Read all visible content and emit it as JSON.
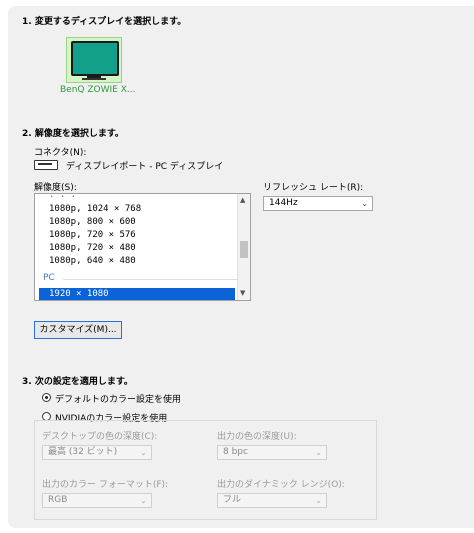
{
  "step1": {
    "title": "1. 変更するディスプレイを選択します。",
    "displays": [
      {
        "name": "BenQ ZOWIE X..."
      }
    ]
  },
  "step2": {
    "title": "2. 解像度を選択します。",
    "connector_label": "コネクタ(N):",
    "connector_value": "ディスプレイポート - PC ディスプレイ",
    "resolution_label": "解像度(S):",
    "resolution_items": [
      "1080p, 1024 × 768",
      "1080p, 800 × 600",
      "1080p, 720 × 576",
      "1080p, 720 × 480",
      "1080p, 640 × 480"
    ],
    "group_label": "PC",
    "selected_resolution": "1920 × 1080",
    "refresh_label": "リフレッシュ レート(R):",
    "refresh_value": "144Hz",
    "customize_button": "カスタマイズ(M)..."
  },
  "step3": {
    "title": "3. 次の設定を適用します。",
    "radio_default": "デフォルトのカラー設定を使用",
    "radio_nvidia": "NVIDIAのカラー設定を使用",
    "desktop_depth_label": "デスクトップの色の深度(C):",
    "desktop_depth_value": "最高 (32 ビット)",
    "output_depth_label": "出力の色の深度(U):",
    "output_depth_value": "8 bpc",
    "output_format_label": "出力のカラー フォーマット(F):",
    "output_format_value": "RGB",
    "output_range_label": "出力のダイナミック レンジ(O):",
    "output_range_value": "フル"
  }
}
